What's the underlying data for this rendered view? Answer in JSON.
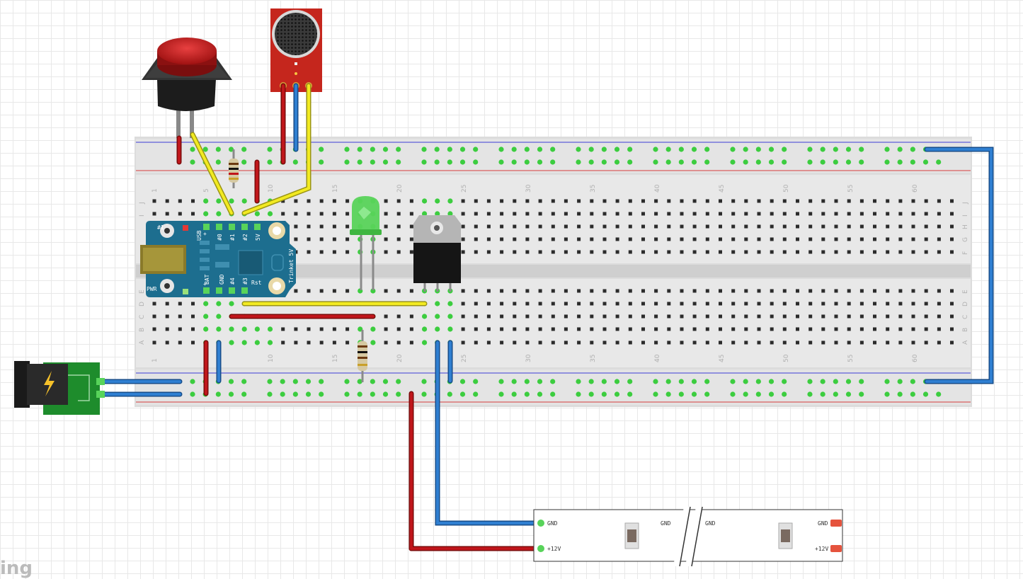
{
  "breadboard": {
    "column_numbers": [
      "1",
      "5",
      "10",
      "15",
      "20",
      "25",
      "30",
      "35",
      "40",
      "45",
      "50",
      "55",
      "60"
    ],
    "row_letters_top": [
      "J",
      "I",
      "H",
      "G",
      "F"
    ],
    "row_letters_bottom": [
      "E",
      "D",
      "C",
      "B",
      "A"
    ]
  },
  "trinket": {
    "top_labels": [
      "USB",
      "#0",
      "#1",
      "#2",
      "5V"
    ],
    "bottom_labels": [
      "BAT",
      "GND",
      "#4",
      "#3",
      "Rst"
    ],
    "side_label": "Trinket 5V",
    "pin1_label": "#1",
    "pwr_label": "PWR",
    "plus_top": "+",
    "plus_bottom": "+"
  },
  "led_strip": {
    "left_labels": [
      "GND",
      "+12V"
    ],
    "mid_left_label": "GND",
    "mid_right_label": "GND",
    "right_labels": [
      "GND",
      "+12V"
    ]
  },
  "watermark": "ing",
  "colors": {
    "wire_red": "#c0161b",
    "wire_blue": "#2f7fd1",
    "wire_yellow": "#f2ea22",
    "board": "#e6e6e6",
    "trinket_blue": "#1d6e8f",
    "led_green": "#58d35a",
    "jack_green": "#1e8c2c"
  }
}
